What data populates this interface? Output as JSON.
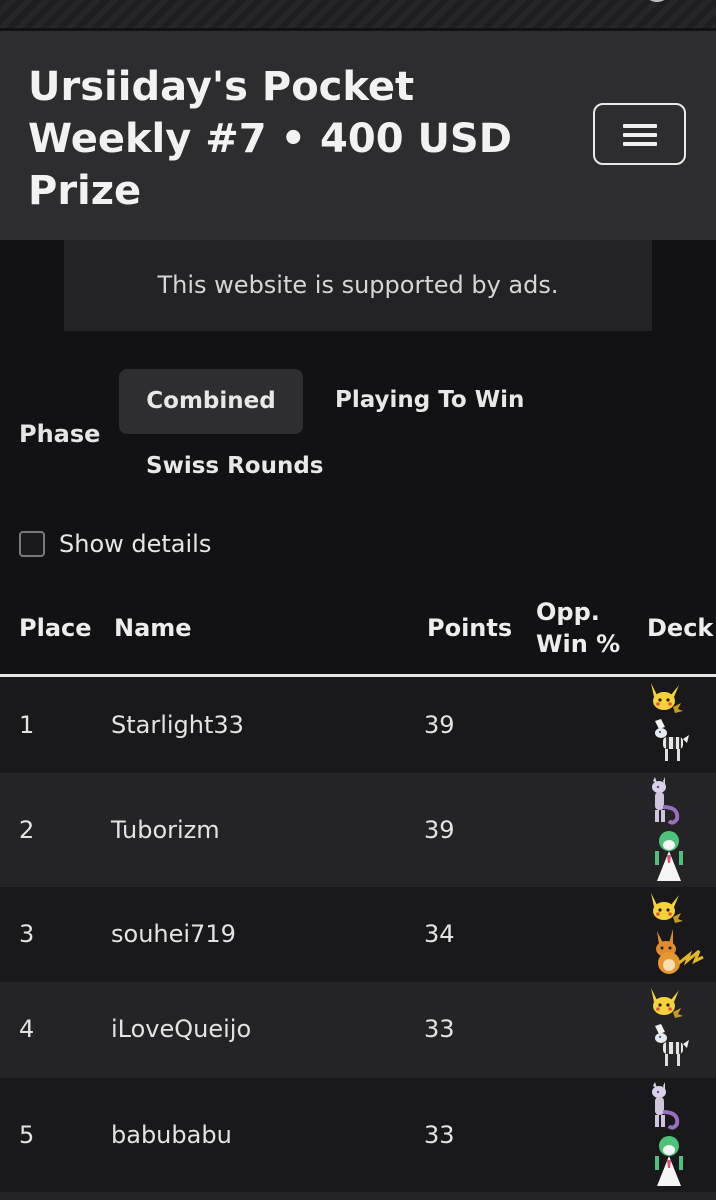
{
  "header": {
    "title": "Ursiiday's Pocket Weekly #7 • 400 USD Prize",
    "menu_icon": "hamburger-menu-icon"
  },
  "ad_notice": "This website is supported by ads.",
  "phase": {
    "label": "Phase",
    "tabs": [
      {
        "label": "Combined",
        "active": true
      },
      {
        "label": "Playing To Win",
        "active": false
      },
      {
        "label": "Swiss Rounds",
        "active": false
      }
    ]
  },
  "show_details": {
    "label": "Show details",
    "checked": false
  },
  "table": {
    "headers": {
      "place": "Place",
      "name": "Name",
      "points": "Points",
      "opp_win_line1": "Opp.",
      "opp_win_line2": "Win %",
      "deck": "Deck"
    },
    "rows": [
      {
        "place": "1",
        "name": "Starlight33",
        "points": "39",
        "deck": [
          "pikachu-icon",
          "zebstrika-icon"
        ]
      },
      {
        "place": "2",
        "name": "Tuborizm",
        "points": "39",
        "deck": [
          "mewtwo-icon",
          "gardevoir-icon"
        ]
      },
      {
        "place": "3",
        "name": "souhei719",
        "points": "34",
        "deck": [
          "pikachu-icon",
          "raichu-icon"
        ]
      },
      {
        "place": "4",
        "name": "iLoveQueijo",
        "points": "33",
        "deck": [
          "pikachu-icon",
          "zebstrika-icon"
        ]
      },
      {
        "place": "5",
        "name": "babubabu",
        "points": "33",
        "deck": [
          "mewtwo-icon",
          "gardevoir-icon"
        ]
      }
    ]
  },
  "colors": {
    "background": "#121214",
    "header_bg": "#2d2d2f",
    "row_odd": "#19191b",
    "row_even": "#242426",
    "active_tab": "#2e2e31"
  }
}
